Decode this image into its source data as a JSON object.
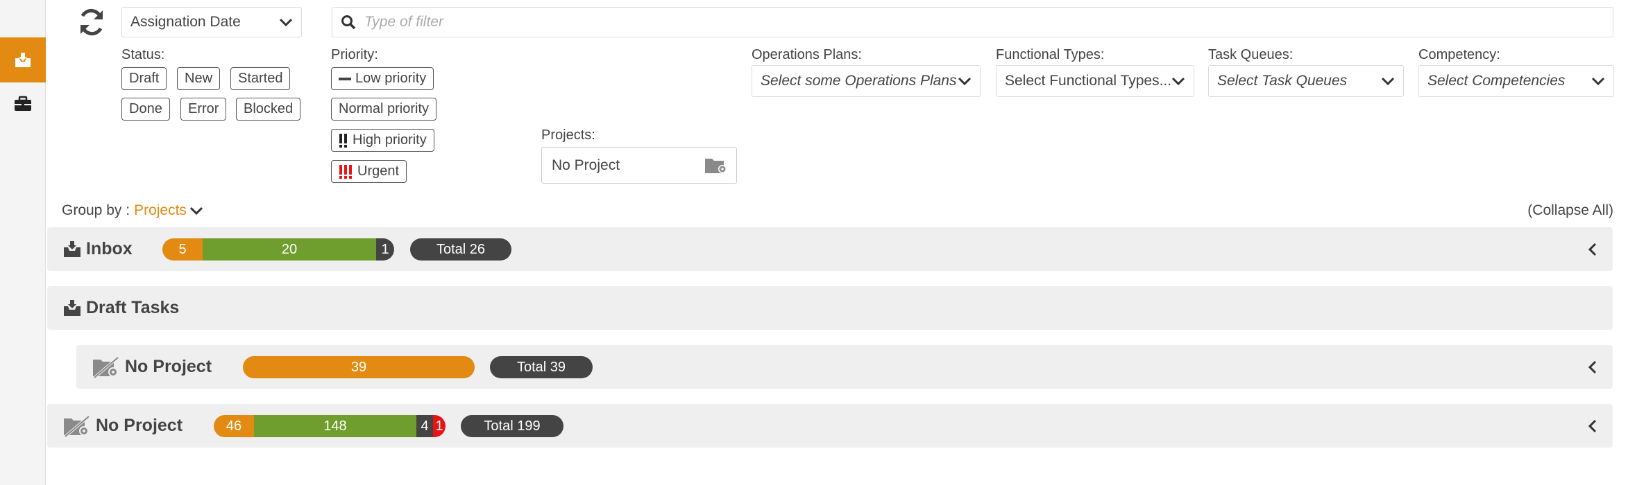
{
  "sidebar": {
    "items": [
      {
        "icon": "inbox-tray-icon"
      },
      {
        "icon": "briefcase-icon"
      }
    ]
  },
  "toolbar": {
    "refresh_icon": "refresh-icon",
    "sort_select": "Assignation Date",
    "filter_placeholder": "Type of filter"
  },
  "filters": {
    "status_label": "Status:",
    "status_chips": [
      "Draft",
      "New",
      "Started",
      "Done",
      "Error",
      "Blocked"
    ],
    "priority_label": "Priority:",
    "priority_chips": [
      "Low priority",
      "Normal priority",
      "High priority",
      "Urgent"
    ],
    "projects_label": "Projects:",
    "projects_value": "No Project",
    "operations_plans_label": "Operations Plans:",
    "operations_plans_placeholder": "Select some Operations Plans",
    "functional_types_label": "Functional Types:",
    "functional_types_value": "Select Functional Types...",
    "task_queues_label": "Task Queues:",
    "task_queues_placeholder": "Select Task Queues",
    "competency_label": "Competency:",
    "competency_placeholder": "Select Competencies"
  },
  "groupby": {
    "label": "Group by :",
    "value": "Projects",
    "collapse_all": "(Collapse All)"
  },
  "groups": [
    {
      "title": "Inbox",
      "segments": [
        {
          "color": "orange",
          "value": "5"
        },
        {
          "color": "green",
          "value": "20"
        },
        {
          "color": "dark",
          "value": "1"
        }
      ],
      "total": "Total 26"
    },
    {
      "title": "Draft Tasks"
    },
    {
      "title": "No Project",
      "segments": [
        {
          "color": "orange",
          "value": "39"
        }
      ],
      "total": "Total 39"
    },
    {
      "title": "No Project",
      "segments": [
        {
          "color": "orange",
          "value": "46"
        },
        {
          "color": "green",
          "value": "148"
        },
        {
          "color": "dark",
          "value": "4"
        },
        {
          "color": "red",
          "value": "1"
        }
      ],
      "total": "Total 199"
    }
  ],
  "colors": {
    "accent": "#e38a12",
    "green": "#6f9e2e",
    "dark": "#444444",
    "red": "#e81414"
  }
}
